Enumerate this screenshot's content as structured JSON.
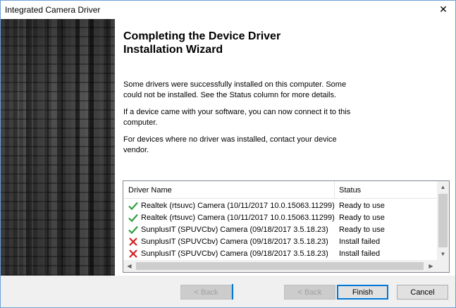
{
  "window": {
    "title": "Integrated Camera Driver",
    "close_glyph": "✕"
  },
  "heading": "Completing the Device Driver\nInstallation Wizard",
  "paragraphs": [
    "Some drivers were successfully installed on this computer. Some could not be installed. See the Status column for more details.",
    "If a device came with your software, you can now connect it to this computer.",
    "For devices where no driver was installed, contact your device vendor."
  ],
  "driver_list": {
    "columns": {
      "name": "Driver Name",
      "status": "Status"
    },
    "rows": [
      {
        "name": "Realtek (rtsuvc) Camera  (10/11/2017 10.0.15063.11299)",
        "status": "Ready to use",
        "icon": "check-icon"
      },
      {
        "name": "Realtek (rtsuvc) Camera  (10/11/2017 10.0.15063.11299)",
        "status": "Ready to use",
        "icon": "check-icon"
      },
      {
        "name": "SunplusIT (SPUVCbv) Camera  (09/18/2017 3.5.18.23)",
        "status": "Ready to use",
        "icon": "check-icon"
      },
      {
        "name": "SunplusIT (SPUVCbv) Camera  (09/18/2017 3.5.18.23)",
        "status": "Install failed",
        "icon": "error-x-icon"
      },
      {
        "name": "SunplusIT (SPUVCbv) Camera  (09/18/2017 3.5.18.23)",
        "status": "Install failed",
        "icon": "error-x-icon"
      }
    ]
  },
  "buttons": {
    "back_1": "< Back",
    "back_2": "< Back",
    "finish": "Finish",
    "cancel": "Cancel"
  },
  "colors": {
    "success": "#2e9e3e",
    "error": "#d32121",
    "accent": "#0078d7"
  }
}
